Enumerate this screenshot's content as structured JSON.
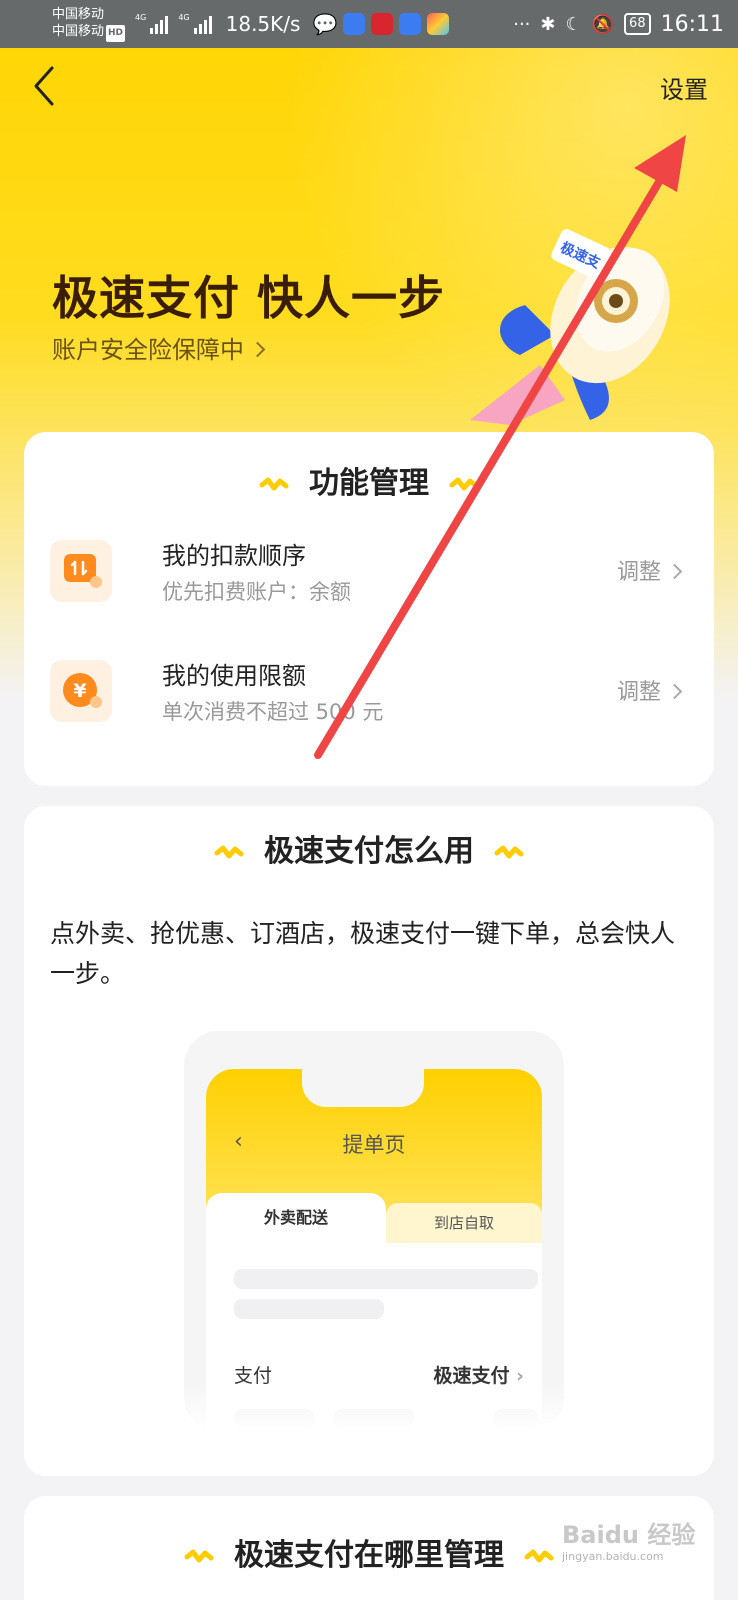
{
  "status_bar": {
    "carrier_1": "中国移动",
    "carrier_2": "中国移动",
    "hd_badge": "HD",
    "signal_tag": "4G",
    "net_speed": "18.5K/s",
    "battery": "68",
    "time": "16:11"
  },
  "nav": {
    "settings_label": "设置"
  },
  "hero": {
    "title": "极速支付 快人一步",
    "subtitle": "账户安全险保障中",
    "rocket_label": "极速支"
  },
  "function_card": {
    "title": "功能管理",
    "items": [
      {
        "title": "我的扣款顺序",
        "desc": "优先扣费账户：余额",
        "action": "调整"
      },
      {
        "title": "我的使用限额",
        "desc": "单次消费不超过 500 元",
        "action": "调整"
      }
    ]
  },
  "howto_card": {
    "title": "极速支付怎么用",
    "body": "点外卖、抢优惠、订酒店，极速支付一键下单，总会快人一步。",
    "mockup": {
      "title": "提单页",
      "tab_active": "外卖配送",
      "tab_inactive": "到店自取",
      "pay_label": "支付",
      "pay_value": "极速支付"
    }
  },
  "manage_card": {
    "title": "极速支付在哪里管理"
  },
  "watermark": {
    "brand": "Baidu 经验",
    "url": "jingyan.baidu.com"
  },
  "colors": {
    "brand_yellow": "#ffd400",
    "title_brown": "#3a1d05",
    "annotation_red": "#f04545"
  }
}
